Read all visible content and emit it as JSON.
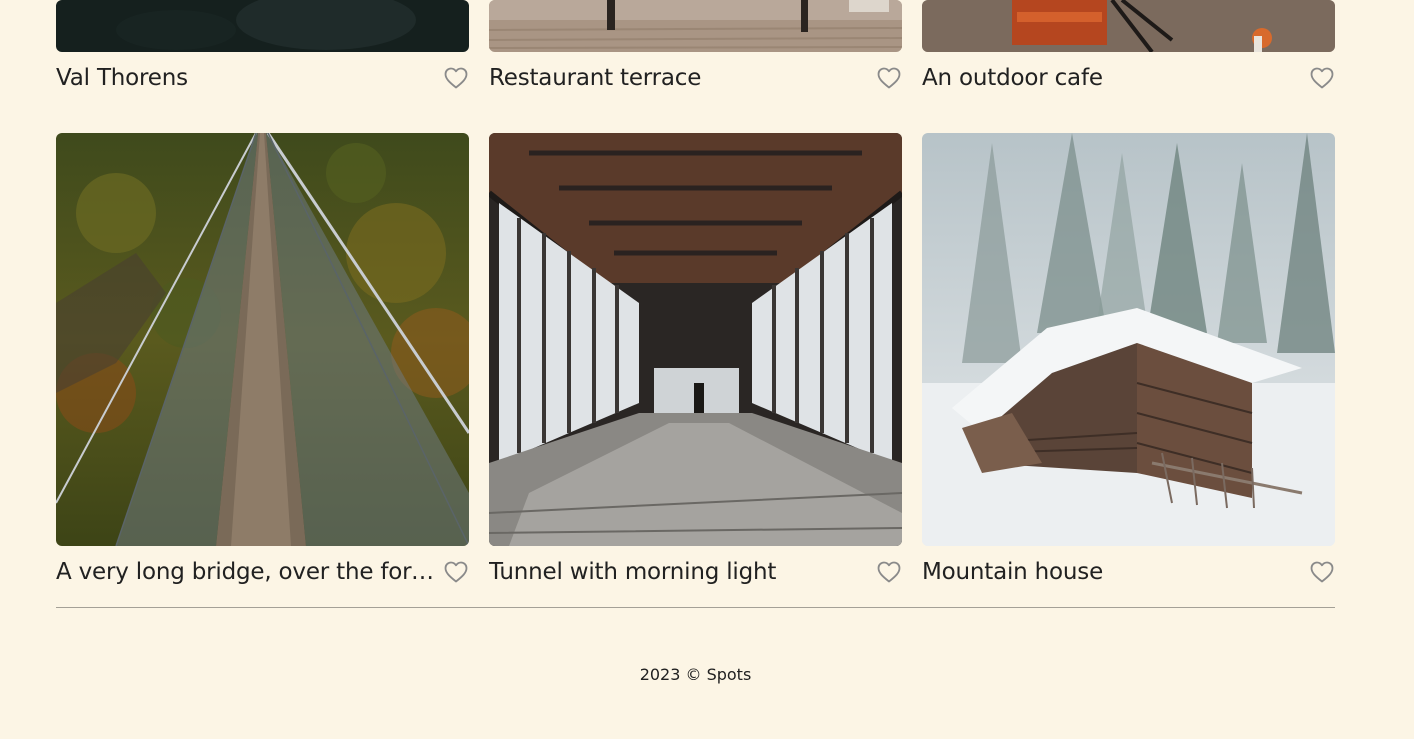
{
  "cards": [
    {
      "title": "Val Thorens",
      "liked": false,
      "image": "val-thorens-image"
    },
    {
      "title": "Restaurant terrace",
      "liked": false,
      "image": "restaurant-terrace-image"
    },
    {
      "title": "An outdoor cafe",
      "liked": false,
      "image": "outdoor-cafe-image"
    },
    {
      "title": "A very long bridge, over the forest and through the trees",
      "liked": false,
      "image": "long-bridge-image"
    },
    {
      "title": "Tunnel with morning light",
      "liked": false,
      "image": "tunnel-image"
    },
    {
      "title": "Mountain house",
      "liked": false,
      "image": "mountain-house-image"
    }
  ],
  "footer": {
    "copyright": "2023 © Spots"
  },
  "icons": {
    "like": "heart-outline-icon"
  },
  "colors": {
    "background": "#fcf5e5",
    "text": "#212121",
    "heart_stroke": "#8a8a8a"
  }
}
